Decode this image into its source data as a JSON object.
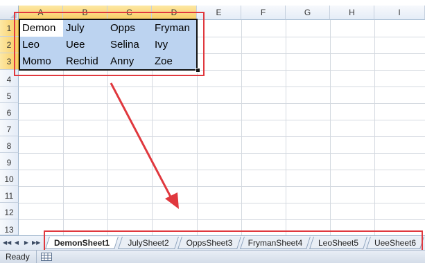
{
  "columns": [
    "A",
    "B",
    "C",
    "D",
    "E",
    "F",
    "G",
    "H",
    "I"
  ],
  "rows": [
    "1",
    "2",
    "3",
    "4",
    "5",
    "6",
    "7",
    "8",
    "9",
    "10",
    "11",
    "12",
    "13"
  ],
  "cells": [
    [
      "Demon",
      "July",
      "Opps",
      "Fryman"
    ],
    [
      "Leo",
      "Uee",
      "Selina",
      "Ivy"
    ],
    [
      "Momo",
      "Rechid",
      "Anny",
      "Zoe"
    ]
  ],
  "sheet_nav": [
    "◀◀",
    "◀",
    "▶",
    "▶▶"
  ],
  "sheet_tabs": [
    "DemonSheet1",
    "JulySheet2",
    "OppsSheet3",
    "FrymanSheet4",
    "LeoSheet5",
    "UeeSheet6"
  ],
  "active_tab": "DemonSheet1",
  "status": {
    "ready": "Ready"
  },
  "colors": {
    "annotation": "#e0383e",
    "selection_fill": "#bcd3f0"
  }
}
